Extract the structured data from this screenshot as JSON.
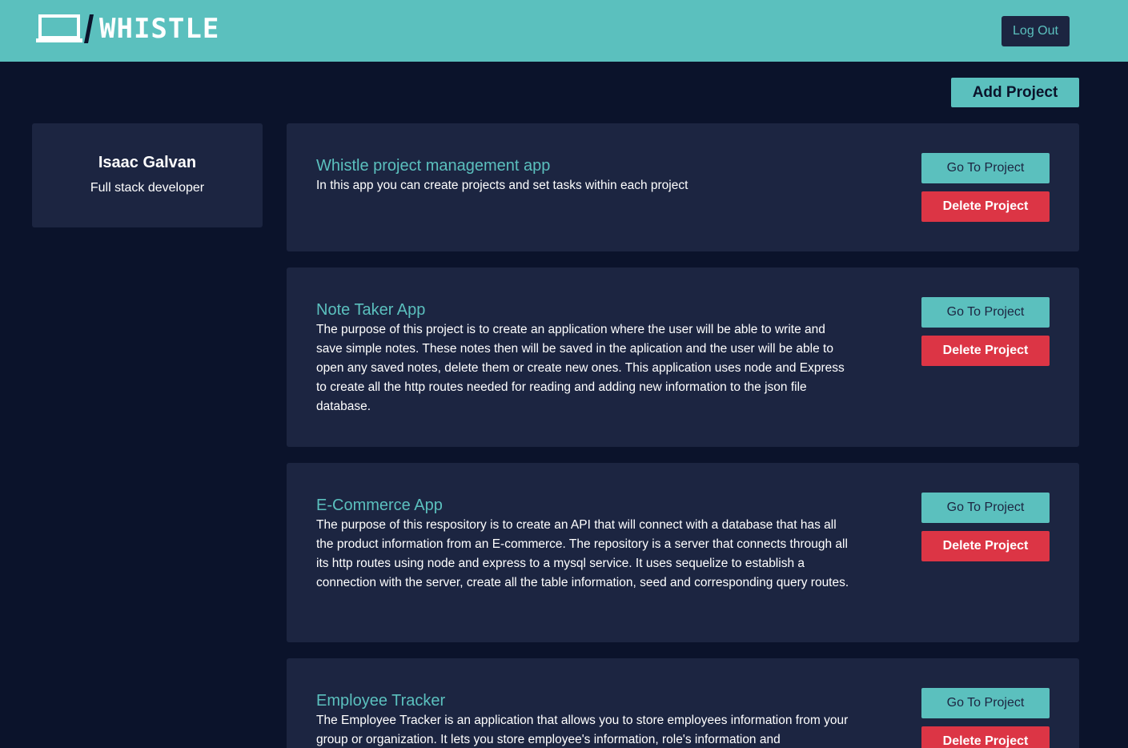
{
  "header": {
    "logo_text": "WHISTLE",
    "logout_label": "Log Out"
  },
  "actions": {
    "add_project_label": "Add Project"
  },
  "profile": {
    "name": "Isaac Galvan",
    "role": "Full stack developer"
  },
  "projects": [
    {
      "title": "Whistle project management app",
      "description": "In this app you can create projects and set tasks within each project",
      "go_label": "Go To Project",
      "delete_label": "Delete Project"
    },
    {
      "title": "Note Taker App",
      "description": "The purpose of this project is to create an application where the user will be able to write and save simple notes. These notes then will be saved in the aplication and the user will be able to open any saved notes, delete them or create new ones. This application uses node and Express to create all the http routes needed for reading and adding new information to the json file database.",
      "go_label": "Go To Project",
      "delete_label": "Delete Project"
    },
    {
      "title": "E-Commerce App",
      "description": "The purpose of this respository is to create an API that will connect with a database that has all the product information from an E-commerce. The repository is a server that connects through all its http routes using node and express to a mysql service. It uses sequelize to establish a connection with the server, create all the table information, seed and corresponding query routes.",
      "go_label": "Go To Project",
      "delete_label": "Delete Project"
    },
    {
      "title": "Employee Tracker",
      "description": "The Employee Tracker is an application that allows you to store employees information from your group or organization. It lets you store employee's information, role's information and",
      "go_label": "Go To Project",
      "delete_label": "Delete Project"
    }
  ],
  "colors": {
    "background": "#0b132b",
    "panel": "#1c2541",
    "accent": "#5bc0be",
    "danger": "#dc3545"
  }
}
